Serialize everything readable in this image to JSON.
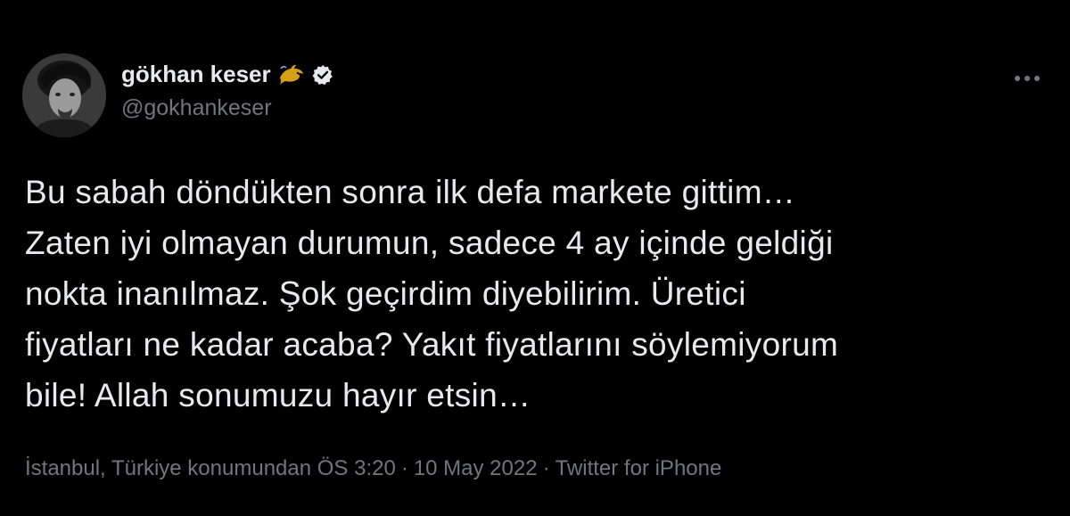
{
  "author": {
    "name": "gökhan keser",
    "handle": "@gokhankeser",
    "emoji_icon": "dolphin-emoji-icon",
    "verified_icon": "verified-badge-icon",
    "avatar_icon": "profile-avatar"
  },
  "more_icon": "more-options-icon",
  "tweet": {
    "lines": [
      "Bu sabah döndükten sonra ilk defa markete gittim…",
      "Zaten iyi olmayan durumun, sadece 4 ay içinde geldiği",
      "nokta inanılmaz. Şok geçirdim diyebilirim. Üretici",
      "fiyatları ne kadar acaba? Yakıt fiyatlarını söylemiyorum",
      "bile! Allah sonumuzu hayır etsin…"
    ]
  },
  "meta": {
    "location_time": "İstanbul, Türkiye konumundan ÖS 3:20",
    "separator": "·",
    "date": "10 May 2022",
    "source": "Twitter for iPhone"
  },
  "colors": {
    "background": "#000000",
    "text": "#e7e9ea",
    "muted": "#71767b"
  }
}
